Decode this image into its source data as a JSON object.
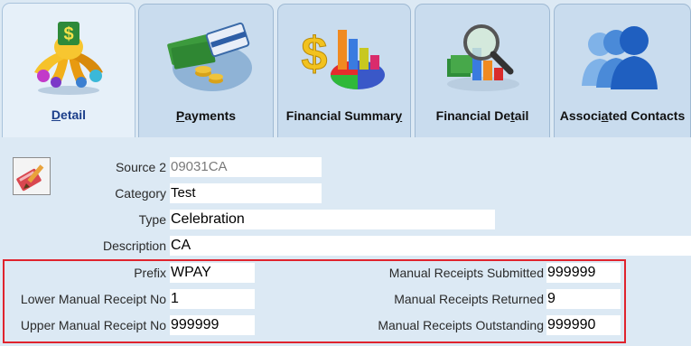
{
  "tabs": [
    {
      "label_pre": "",
      "label_ul": "D",
      "label_post": "etail",
      "icon": "money-hand-icon",
      "active": true
    },
    {
      "label_pre": "",
      "label_ul": "P",
      "label_post": "ayments",
      "icon": "payment-cards-icon",
      "active": false
    },
    {
      "label_pre": "Financial Summar",
      "label_ul": "y",
      "label_post": "",
      "icon": "financial-chart-icon",
      "active": false
    },
    {
      "label_pre": "Financial De",
      "label_ul": "t",
      "label_post": "ail",
      "icon": "magnifier-chart-icon",
      "active": false
    },
    {
      "label_pre": "Associ",
      "label_ul": "a",
      "label_post": "ted Contacts",
      "icon": "contacts-group-icon",
      "active": false
    }
  ],
  "form": {
    "edit_icon": "edit-pencil-icon",
    "source2": {
      "label": "Source 2",
      "value": "09031CA"
    },
    "category": {
      "label": "Category",
      "value": "Test"
    },
    "type": {
      "label": "Type",
      "value": "Celebration"
    },
    "description": {
      "label": "Description",
      "value": "CA"
    },
    "prefix": {
      "label": "Prefix",
      "value": "WPAY"
    },
    "lower_receipt": {
      "label": "Lower Manual Receipt No",
      "value": "1"
    },
    "upper_receipt": {
      "label": "Upper Manual Receipt No",
      "value": "999999"
    },
    "receipts_submitted": {
      "label": "Manual Receipts Submitted",
      "value": "999999"
    },
    "receipts_returned": {
      "label": "Manual Receipts Returned",
      "value": "9"
    },
    "receipts_outstanding": {
      "label": "Manual Receipts Outstanding",
      "value": "999990"
    }
  },
  "colors": {
    "highlight": "#e0232d",
    "active_tab_label": "#1b3e8a"
  }
}
